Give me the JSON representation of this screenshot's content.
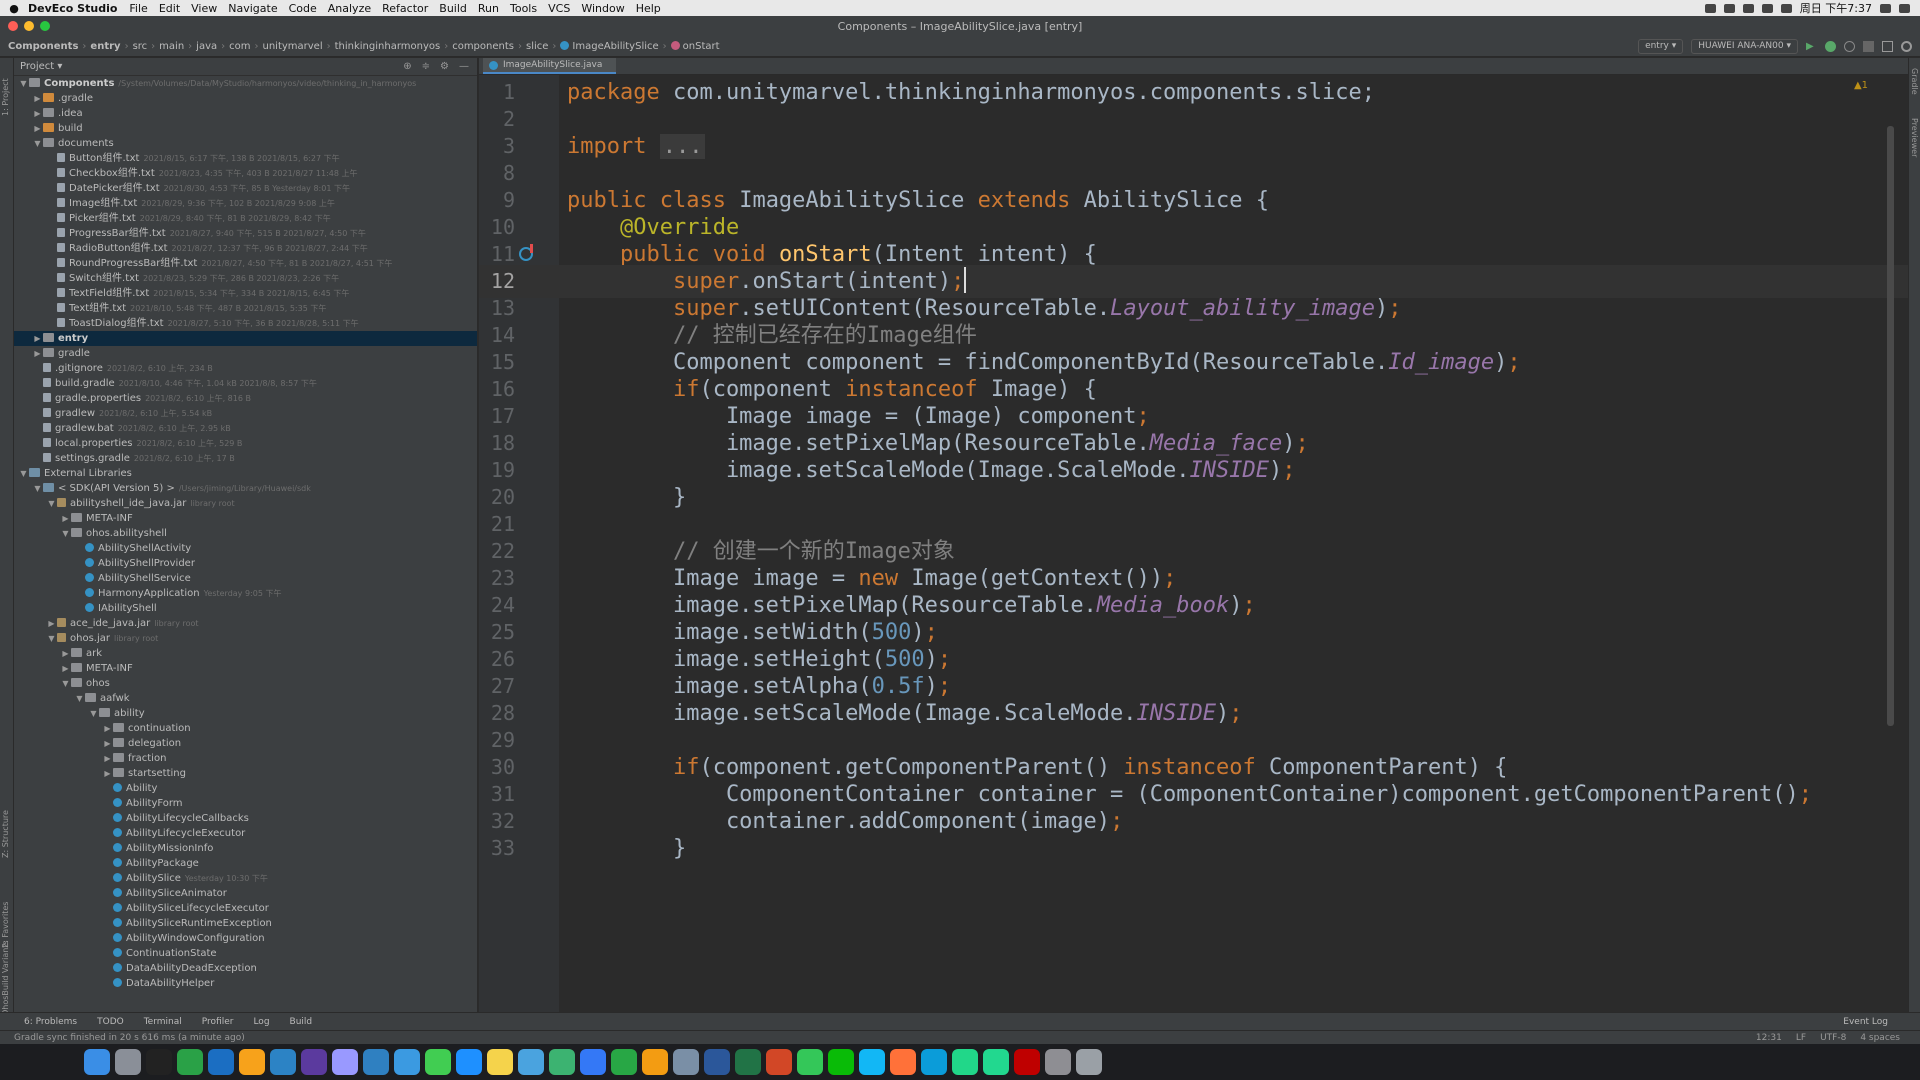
{
  "menubar": {
    "app_name": "DevEco Studio",
    "items": [
      "File",
      "Edit",
      "View",
      "Navigate",
      "Code",
      "Analyze",
      "Refactor",
      "Build",
      "Run",
      "Tools",
      "VCS",
      "Window",
      "Help"
    ],
    "clock": "周日 下午7:37"
  },
  "window": {
    "title": "Components – ImageAbilitySlice.java [entry]"
  },
  "breadcrumbs": [
    "Components",
    "entry",
    "src",
    "main",
    "java",
    "com",
    "unitymarvel",
    "thinkinginharmonyos",
    "components",
    "slice",
    "ImageAbilitySlice",
    "onStart"
  ],
  "toolbar": {
    "run_config": "entry",
    "device": "HUAWEI ANA-AN00"
  },
  "project_panel": {
    "title": "Project",
    "tree": [
      {
        "label": "Components",
        "meta": "/System/Volumes/Data/MyStudio/harmonyos/video/thinking_in_harmonyos",
        "type": "folder",
        "depth": 0,
        "open": true,
        "bold": true
      },
      {
        "label": ".gradle",
        "meta": "",
        "type": "ofolder",
        "depth": 1,
        "open": false
      },
      {
        "label": ".idea",
        "meta": "",
        "type": "folder",
        "depth": 1,
        "open": false
      },
      {
        "label": "build",
        "meta": "",
        "type": "ofolder",
        "depth": 1,
        "open": false
      },
      {
        "label": "documents",
        "meta": "",
        "type": "folder",
        "depth": 1,
        "open": true
      },
      {
        "label": "Button组件.txt",
        "meta": "2021/8/15, 6:17 下午, 138 B 2021/8/15, 6:27 下午",
        "type": "file",
        "depth": 2
      },
      {
        "label": "Checkbox组件.txt",
        "meta": "2021/8/23, 4:35 下午, 403 B 2021/8/27 11:48 上午",
        "type": "file",
        "depth": 2
      },
      {
        "label": "DatePicker组件.txt",
        "meta": "2021/8/30, 4:53 下午, 85 B Yesterday 8:01 下午",
        "type": "file",
        "depth": 2
      },
      {
        "label": "Image组件.txt",
        "meta": "2021/8/29, 9:36 下午, 102 B 2021/8/29 9:08 上午",
        "type": "file",
        "depth": 2
      },
      {
        "label": "Picker组件.txt",
        "meta": "2021/8/29, 8:40 下午, 81 B 2021/8/29, 8:42 下午",
        "type": "file",
        "depth": 2
      },
      {
        "label": "ProgressBar组件.txt",
        "meta": "2021/8/27, 9:40 下午, 515 B 2021/8/27, 4:50 下午",
        "type": "file",
        "depth": 2
      },
      {
        "label": "RadioButton组件.txt",
        "meta": "2021/8/27, 12:37 下午, 96 B 2021/8/27, 2:44 下午",
        "type": "file",
        "depth": 2
      },
      {
        "label": "RoundProgressBar组件.txt",
        "meta": "2021/8/27, 4:50 下午, 81 B 2021/8/27, 4:51 下午",
        "type": "file",
        "depth": 2
      },
      {
        "label": "Switch组件.txt",
        "meta": "2021/8/23, 5:29 下午, 286 B 2021/8/23, 2:26 下午",
        "type": "file",
        "depth": 2
      },
      {
        "label": "TextField组件.txt",
        "meta": "2021/8/15, 5:34 下午, 334 B 2021/8/15, 6:45 下午",
        "type": "file",
        "depth": 2
      },
      {
        "label": "Text组件.txt",
        "meta": "2021/8/10, 5:48 下午, 487 B 2021/8/15, 5:35 下午",
        "type": "file",
        "depth": 2
      },
      {
        "label": "ToastDialog组件.txt",
        "meta": "2021/8/27, 5:10 下午, 36 B 2021/8/28, 5:11 下午",
        "type": "file",
        "depth": 2
      },
      {
        "label": "entry",
        "meta": "",
        "type": "folder",
        "depth": 1,
        "open": false,
        "bold": true,
        "sel": true
      },
      {
        "label": "gradle",
        "meta": "",
        "type": "folder",
        "depth": 1,
        "open": false
      },
      {
        "label": ".gitignore",
        "meta": "2021/8/2, 6:10 上午, 234 B",
        "type": "file",
        "depth": 1
      },
      {
        "label": "build.gradle",
        "meta": "2021/8/10, 4:46 下午, 1.04 kB 2021/8/8, 8:57 下午",
        "type": "file",
        "depth": 1
      },
      {
        "label": "gradle.properties",
        "meta": "2021/8/2, 6:10 上午, 816 B",
        "type": "file",
        "depth": 1
      },
      {
        "label": "gradlew",
        "meta": "2021/8/2, 6:10 上午, 5.54 kB",
        "type": "file",
        "depth": 1
      },
      {
        "label": "gradlew.bat",
        "meta": "2021/8/2, 6:10 上午, 2.95 kB",
        "type": "file",
        "depth": 1
      },
      {
        "label": "local.properties",
        "meta": "2021/8/2, 6:10 上午, 529 B",
        "type": "file",
        "depth": 1
      },
      {
        "label": "settings.gradle",
        "meta": "2021/8/2, 6:10 上午, 17 B",
        "type": "file",
        "depth": 1
      },
      {
        "label": "External Libraries",
        "meta": "",
        "type": "lib",
        "depth": 0,
        "open": true
      },
      {
        "label": "< SDK(API Version 5) >",
        "meta": "/Users/jiming/Library/Huawei/sdk",
        "type": "lib",
        "depth": 1,
        "open": true
      },
      {
        "label": "abilityshell_ide_java.jar",
        "meta": "library root",
        "type": "jar",
        "depth": 2,
        "open": true
      },
      {
        "label": "META-INF",
        "meta": "",
        "type": "folder",
        "depth": 3,
        "open": false
      },
      {
        "label": "ohos.abilityshell",
        "meta": "",
        "type": "folder",
        "depth": 3,
        "open": true
      },
      {
        "label": "AbilityShellActivity",
        "meta": "",
        "type": "cls",
        "depth": 4
      },
      {
        "label": "AbilityShellProvider",
        "meta": "",
        "type": "cls",
        "depth": 4
      },
      {
        "label": "AbilityShellService",
        "meta": "",
        "type": "cls",
        "depth": 4
      },
      {
        "label": "HarmonyApplication",
        "meta": "Yesterday 9:05 下午",
        "type": "cls",
        "depth": 4
      },
      {
        "label": "IAbilityShell",
        "meta": "",
        "type": "cls",
        "depth": 4
      },
      {
        "label": "ace_ide_java.jar",
        "meta": "library root",
        "type": "jar",
        "depth": 2,
        "open": false
      },
      {
        "label": "ohos.jar",
        "meta": "library root",
        "type": "jar",
        "depth": 2,
        "open": true
      },
      {
        "label": "ark",
        "meta": "",
        "type": "folder",
        "depth": 3,
        "open": false
      },
      {
        "label": "META-INF",
        "meta": "",
        "type": "folder",
        "depth": 3,
        "open": false
      },
      {
        "label": "ohos",
        "meta": "",
        "type": "folder",
        "depth": 3,
        "open": true
      },
      {
        "label": "aafwk",
        "meta": "",
        "type": "folder",
        "depth": 4,
        "open": true
      },
      {
        "label": "ability",
        "meta": "",
        "type": "folder",
        "depth": 5,
        "open": true
      },
      {
        "label": "continuation",
        "meta": "",
        "type": "folder",
        "depth": 6,
        "open": false
      },
      {
        "label": "delegation",
        "meta": "",
        "type": "folder",
        "depth": 6,
        "open": false
      },
      {
        "label": "fraction",
        "meta": "",
        "type": "folder",
        "depth": 6,
        "open": false
      },
      {
        "label": "startsetting",
        "meta": "",
        "type": "folder",
        "depth": 6,
        "open": false
      },
      {
        "label": "Ability",
        "meta": "",
        "type": "cls",
        "depth": 6
      },
      {
        "label": "AbilityForm",
        "meta": "",
        "type": "cls",
        "depth": 6
      },
      {
        "label": "AbilityLifecycleCallbacks",
        "meta": "",
        "type": "cls",
        "depth": 6
      },
      {
        "label": "AbilityLifecycleExecutor",
        "meta": "",
        "type": "cls",
        "depth": 6
      },
      {
        "label": "AbilityMissionInfo",
        "meta": "",
        "type": "cls",
        "depth": 6
      },
      {
        "label": "AbilityPackage",
        "meta": "",
        "type": "cls",
        "depth": 6
      },
      {
        "label": "AbilitySlice",
        "meta": "Yesterday 10:30 下午",
        "type": "cls",
        "depth": 6
      },
      {
        "label": "AbilitySliceAnimator",
        "meta": "",
        "type": "cls",
        "depth": 6
      },
      {
        "label": "AbilitySliceLifecycleExecutor",
        "meta": "",
        "type": "cls",
        "depth": 6
      },
      {
        "label": "AbilitySliceRuntimeException",
        "meta": "",
        "type": "cls",
        "depth": 6
      },
      {
        "label": "AbilityWindowConfiguration",
        "meta": "",
        "type": "cls",
        "depth": 6
      },
      {
        "label": "ContinuationState",
        "meta": "",
        "type": "cls",
        "depth": 6
      },
      {
        "label": "DataAbilityDeadException",
        "meta": "",
        "type": "cls",
        "depth": 6
      },
      {
        "label": "DataAbilityHelper",
        "meta": "",
        "type": "cls",
        "depth": 6
      }
    ]
  },
  "editor": {
    "tab_label": "ImageAbilitySlice.java",
    "warning_count": "▲1",
    "current_line": "12",
    "lines": [
      {
        "n": "1",
        "html": "<span class='kw'>package</span> com.unitymarvel.thinkinginharmonyos.components.slice;"
      },
      {
        "n": "2",
        "html": ""
      },
      {
        "n": "3",
        "html": "<span class='kw'>import</span> <span class='fold'>...</span>"
      },
      {
        "n": "8",
        "html": ""
      },
      {
        "n": "9",
        "html": "<span class='kw'>public class</span> ImageAbilitySlice <span class='kw'>extends</span> AbilitySlice {"
      },
      {
        "n": "10",
        "html": "    <span class='ann'>@Override</span>"
      },
      {
        "n": "11",
        "html": "    <span class='kw'>public void</span> <span class='mth'>onStart</span>(Intent intent) {"
      },
      {
        "n": "12",
        "html": "        <span class='kw'>super</span>.onStart(intent)<span class='kw'>;</span><span class='caret'></span>"
      },
      {
        "n": "13",
        "html": "        <span class='kw'>super</span>.setUIContent(ResourceTable.<span class='ital'>Layout_ability_image</span>)<span class='kw'>;</span>"
      },
      {
        "n": "14",
        "html": "        <span class='cmt'>// 控制已经存在的Image组件</span>"
      },
      {
        "n": "15",
        "html": "        Component component = findComponentById(ResourceTable.<span class='ital'>Id_image</span>)<span class='kw'>;</span>"
      },
      {
        "n": "16",
        "html": "        <span class='kw'>if</span>(component <span class='kw'>instanceof</span> Image) {"
      },
      {
        "n": "17",
        "html": "            Image image = (Image) component<span class='kw'>;</span>"
      },
      {
        "n": "18",
        "html": "            image.setPixelMap(ResourceTable.<span class='ital'>Media_face</span>)<span class='kw'>;</span>"
      },
      {
        "n": "19",
        "html": "            image.setScaleMode(Image.ScaleMode.<span class='ital'>INSIDE</span>)<span class='kw'>;</span>"
      },
      {
        "n": "20",
        "html": "        }"
      },
      {
        "n": "21",
        "html": ""
      },
      {
        "n": "22",
        "html": "        <span class='cmt'>// 创建一个新的Image对象</span>"
      },
      {
        "n": "23",
        "html": "        Image image = <span class='kw'>new</span> Image(getContext())<span class='kw'>;</span>"
      },
      {
        "n": "24",
        "html": "        image.setPixelMap(ResourceTable.<span class='ital'>Media_book</span>)<span class='kw'>;</span>"
      },
      {
        "n": "25",
        "html": "        image.setWidth(<span class='num'>500</span>)<span class='kw'>;</span>"
      },
      {
        "n": "26",
        "html": "        image.setHeight(<span class='num'>500</span>)<span class='kw'>;</span>"
      },
      {
        "n": "27",
        "html": "        image.setAlpha(<span class='num'>0.5f</span>)<span class='kw'>;</span>"
      },
      {
        "n": "28",
        "html": "        image.setScaleMode(Image.ScaleMode.<span class='ital'>INSIDE</span>)<span class='kw'>;</span>"
      },
      {
        "n": "29",
        "html": ""
      },
      {
        "n": "30",
        "html": "        <span class='kw'>if</span>(component.getComponentParent() <span class='kw'>instanceof</span> ComponentParent) {"
      },
      {
        "n": "31",
        "html": "            ComponentContainer container = (ComponentContainer)component.getComponentParent()<span class='kw'>;</span>"
      },
      {
        "n": "32",
        "html": "            container.addComponent(image)<span class='kw'>;</span>"
      },
      {
        "n": "33",
        "html": "        }"
      }
    ]
  },
  "tool_windows": {
    "left": [
      "1: Project",
      "Z: Structure",
      "2: Favorites",
      "OhosBuild Variants"
    ],
    "right": [
      "Gradle",
      "Previewer"
    ],
    "bottom": [
      "6: Problems",
      "TODO",
      "Terminal",
      "Profiler",
      "Log",
      "Build"
    ],
    "event_log": "Event Log"
  },
  "status": {
    "message": "Gradle sync finished in 20 s 616 ms (a minute ago)",
    "position": "12:31",
    "line_sep": "LF",
    "encoding": "UTF-8",
    "indent": "4 spaces"
  },
  "colors": {
    "keyword": "#cc7832",
    "annotation": "#bbb529",
    "method": "#ffc66d",
    "number": "#6897bb",
    "field": "#9876aa",
    "comment": "#808080",
    "selection": "#2f65ca"
  },
  "dock_apps": [
    "finder",
    "launchpad",
    "terminal",
    "chrome",
    "xcode",
    "illustrator",
    "photoshop",
    "premiere",
    "after-effects",
    "vscode",
    "safari",
    "qt",
    "deveco",
    "notes",
    "mail",
    "maps",
    "keynote",
    "numbers",
    "pages",
    "preview",
    "word",
    "excel",
    "powerpoint",
    "messages",
    "wechat",
    "qq",
    "firefox",
    "goland",
    "pycharm",
    "clion",
    "filezilla",
    "settings",
    "trash"
  ]
}
